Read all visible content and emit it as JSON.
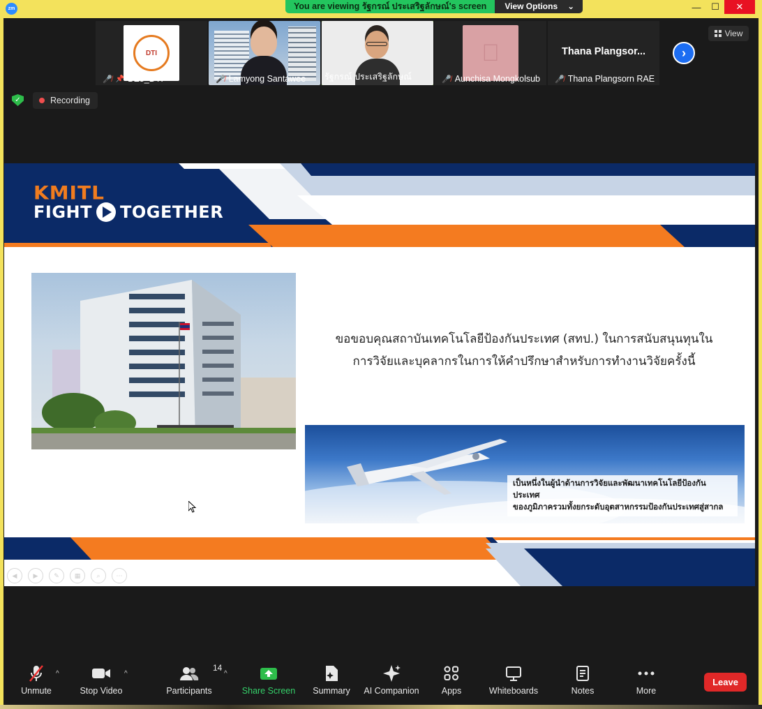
{
  "window": {
    "app_logo": "zm",
    "viewing_banner": "You are viewing รัฐกรณ์ ประเสริฐลักษณ์'s screen",
    "view_options_label": "View Options",
    "controls": [
      "minimize",
      "maximize",
      "close"
    ]
  },
  "participants": [
    {
      "name": "DZ5_DTI",
      "type": "logo",
      "muted": true,
      "pinned": true
    },
    {
      "name": "Lamyong Santawee",
      "type": "photo",
      "muted": true
    },
    {
      "name": "รัฐกรณ์ ประเสริฐลักษณ์",
      "type": "photo",
      "muted": false,
      "active": true
    },
    {
      "name": "Aunchisa Mongkolsub",
      "type": "logo",
      "muted": true
    },
    {
      "name": "Thana Plangsorn RAE",
      "display": "Thana  Plangsor...",
      "type": "name-only",
      "muted": true
    }
  ],
  "view_button_label": "View",
  "recording_label": "Recording",
  "slide": {
    "logo_top": "KMITL",
    "logo_bottom_left": "FIGHT",
    "logo_bottom_right": "TOGETHER",
    "thanks_line1": "ขอขอบคุณสถาบันเทคโนโลยีป้องกันประเทศ (สทป.) ในการสนับสนุนทุนใน",
    "thanks_line2": "การวิจัยและบุคลากรในการให้คำปรึกษาสำหรับการทำงานวิจัยครั้งนี้",
    "banner_line1": "เป็นหนึ่งในผู้นำด้านการวิจัยและพัฒนาเทคโนโลยีป้องกันประเทศ",
    "banner_line2": "ของภูมิภาครวมทั้งยกระดับอุตสาหกรรมป้องกันประเทศสู่สากล",
    "colors": {
      "navy": "#0b2a67",
      "orange": "#f47b20",
      "light_blue": "#c7d4e6"
    }
  },
  "toolbar": {
    "unmute": "Unmute",
    "stop_video": "Stop Video",
    "participants": "Participants",
    "participants_count": "14",
    "share_screen": "Share Screen",
    "summary": "Summary",
    "ai_companion": "AI Companion",
    "apps": "Apps",
    "whiteboards": "Whiteboards",
    "notes": "Notes",
    "more": "More",
    "leave": "Leave"
  }
}
